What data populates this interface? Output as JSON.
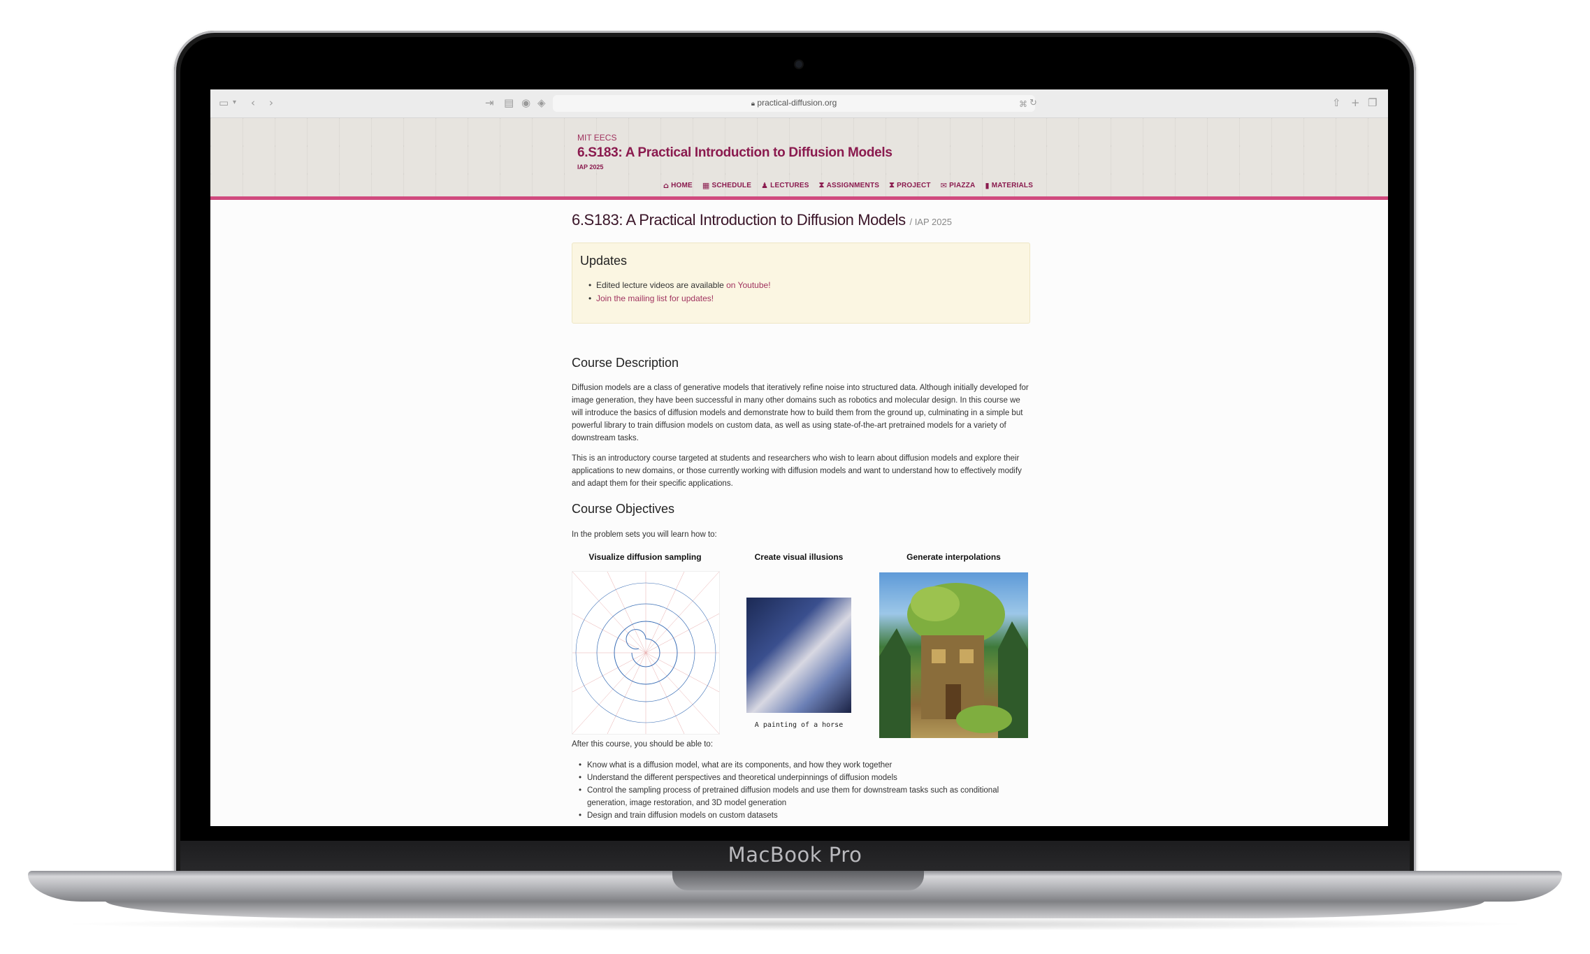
{
  "device": {
    "brand": "MacBook Pro"
  },
  "browser": {
    "url": "practical-diffusion.org",
    "icons": [
      "sidebar-icon",
      "chevron-down-icon",
      "back-icon",
      "forward-icon",
      "reader-icon",
      "page-icon",
      "shield-icon",
      "extension-icon",
      "tab-overview-icon",
      "lock-icon",
      "translate-icon",
      "reload-icon",
      "share-icon",
      "new-tab-icon",
      "tabs-icon"
    ]
  },
  "site_header": {
    "dept": "MIT EECS",
    "title": "6.S183: A Practical Introduction to Diffusion Models",
    "term": "IAP 2025",
    "accent_color": "#d04a7e",
    "nav": [
      {
        "label": "Home",
        "icon": "home-icon"
      },
      {
        "label": "Schedule",
        "icon": "calendar-icon"
      },
      {
        "label": "Lectures",
        "icon": "lecture-icon"
      },
      {
        "label": "Assignments",
        "icon": "hourglass-icon"
      },
      {
        "label": "Project",
        "icon": "hourglass-icon"
      },
      {
        "label": "Piazza",
        "icon": "chat-icon"
      },
      {
        "label": "Materials",
        "icon": "book-icon"
      }
    ]
  },
  "page": {
    "title": "6.S183: A Practical Introduction to Diffusion Models",
    "subtitle": "/ IAP 2025",
    "updates": {
      "heading": "Updates",
      "item1_text": "Edited lecture videos are available ",
      "item1_link": "on Youtube!",
      "item2_link": "Join the mailing list for updates!"
    },
    "description": {
      "heading": "Course Description",
      "p1": "Diffusion models are a class of generative models that iteratively refine noise into structured data. Although initially developed for image generation, they have been successful in many other domains such as robotics and molecular design. In this course we will introduce the basics of diffusion models and demonstrate how to build them from the ground up, culminating in a simple but powerful library to train diffusion models on custom data, as well as using state-of-the-art pretrained models for a variety of downstream tasks.",
      "p2": "This is an introductory course targeted at students and researchers who wish to learn about diffusion models and explore their applications to new domains, or those currently working with diffusion models and want to understand how to effectively modify and adapt them for their specific applications."
    },
    "objectives": {
      "heading": "Course Objectives",
      "intro": "In the problem sets you will learn how to:",
      "captions": [
        "Visualize diffusion sampling",
        "Create visual illusions",
        "Generate interpolations"
      ],
      "illusion_caption": "A painting of a horse",
      "outro": "After this course, you should be able to:",
      "bullets": [
        "Know what is a diffusion model, what are its components, and how they work together",
        "Understand the different perspectives and theoretical underpinnings of diffusion models",
        "Control the sampling process of pretrained diffusion models and use them for downstream tasks such as conditional generation, image restoration, and 3D model generation",
        "Design and train diffusion models on custom datasets"
      ]
    }
  }
}
